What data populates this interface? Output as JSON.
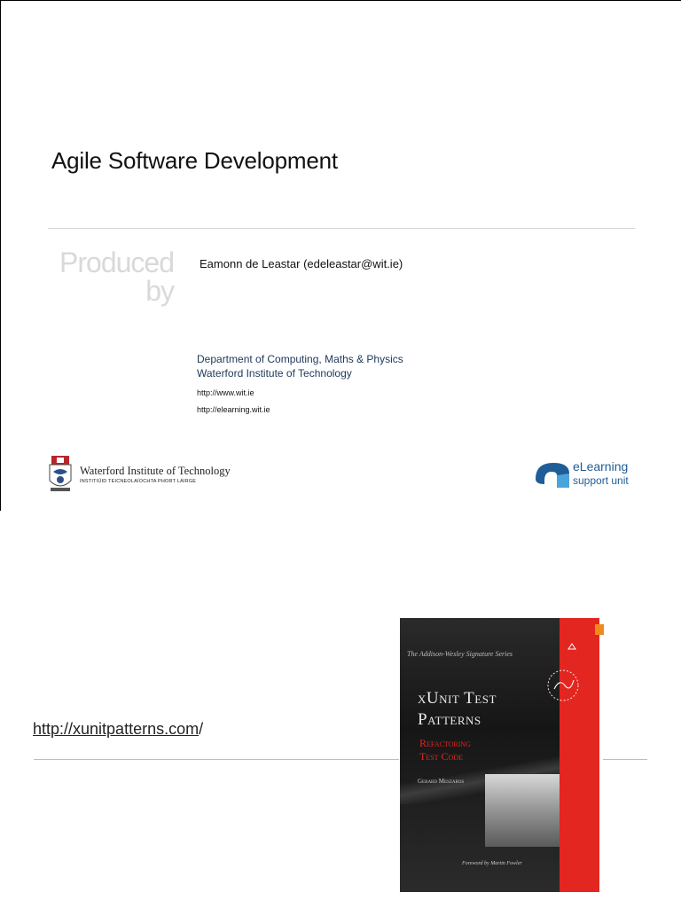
{
  "slide1": {
    "title": "Agile Software Development",
    "produced_by_line1": "Produced",
    "produced_by_line2": "by",
    "author": "Eamonn de Leastar (edeleastar@wit.ie)",
    "department": "Department of Computing, Maths & Physics",
    "institute": "Waterford Institute of Technology",
    "urls": [
      "http://www.wit.ie",
      "http://elearning.wit.ie"
    ],
    "wit_logo": {
      "name": "Waterford Institute of Technology",
      "subtitle": "INSTITIÚID TEICNEOLAÍOCHTA PHORT LÁIRGE"
    },
    "elearning_logo": {
      "line1": "eLearning",
      "line2": "support unit",
      "color": "#1f5d97"
    }
  },
  "slide2": {
    "link_text": "http://xunitpatterns.com",
    "link_suffix": "/",
    "book": {
      "series": "The Addison-Wesley Signature Series",
      "title_line1": "xUnit Test",
      "title_line2": "Patterns",
      "subtitle_line1": "Refactoring",
      "subtitle_line2": "Test Code",
      "author": "Gerard Meszaros",
      "foreword": "Foreword by Martin Fowler",
      "accent_color": "#e3261f"
    }
  }
}
